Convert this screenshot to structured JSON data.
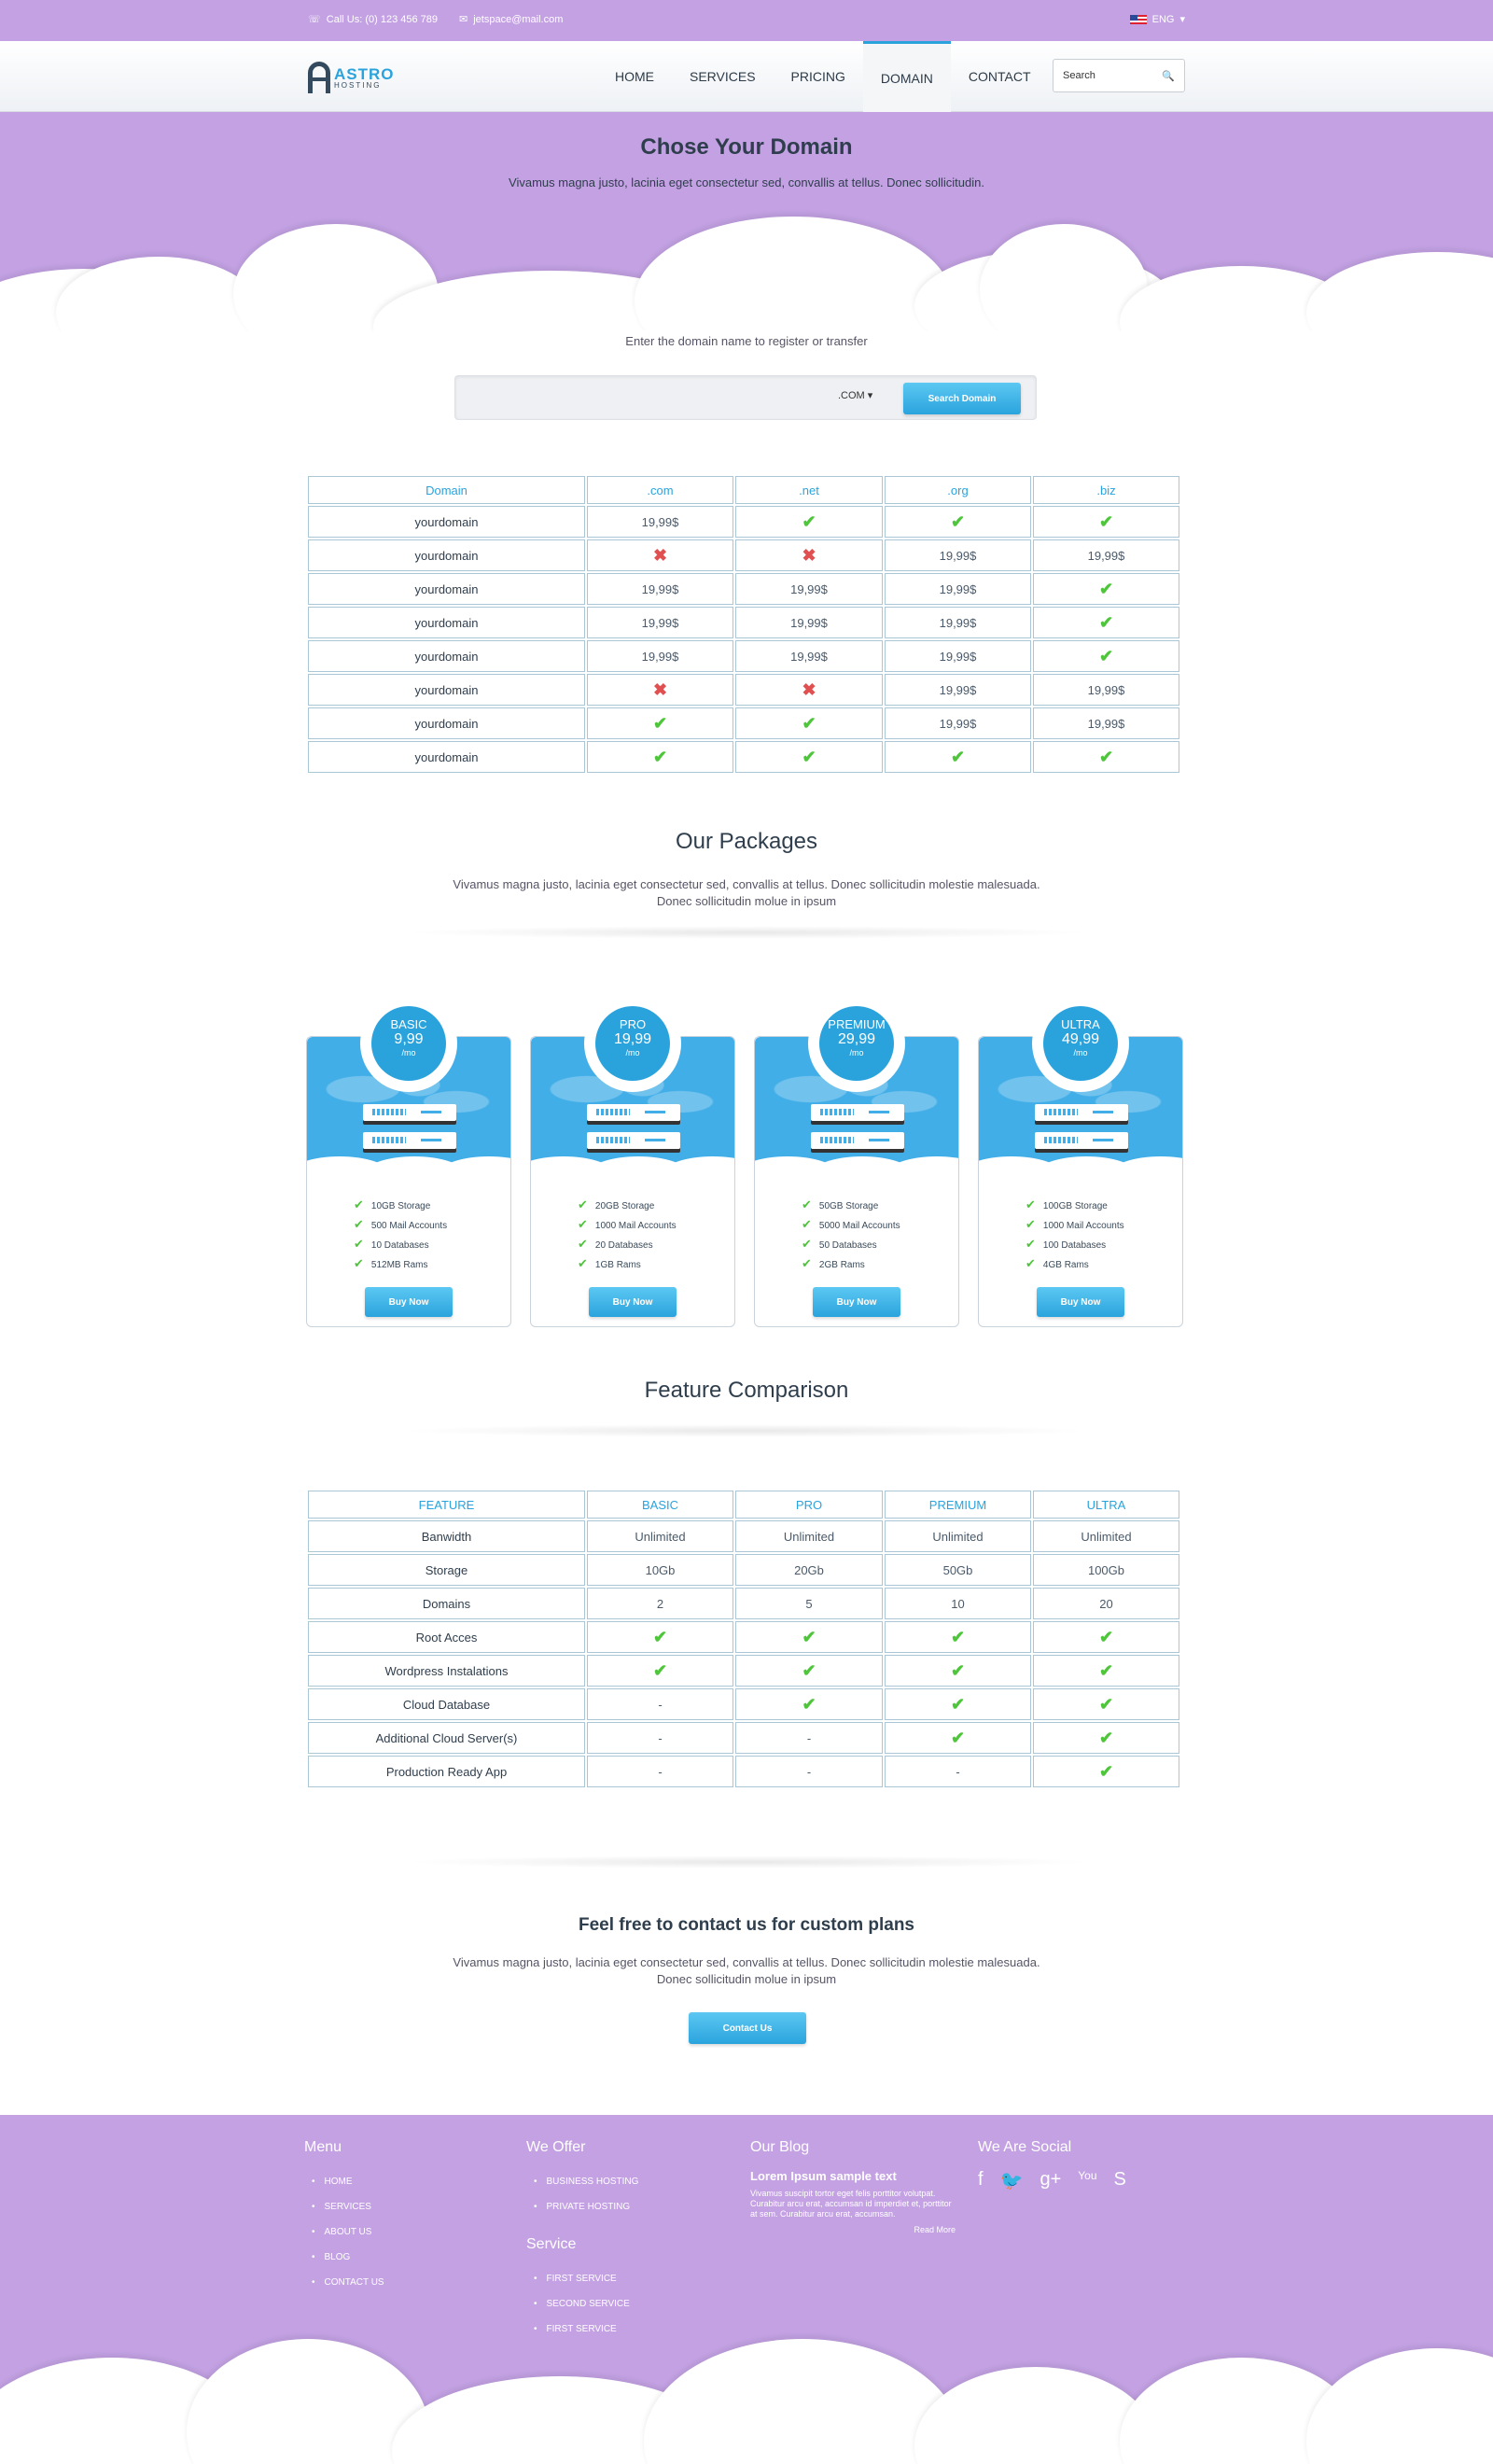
{
  "topbar": {
    "phone": "Call Us: (0) 123 456 789",
    "email": "jetspace@mail.com",
    "language": "ENG"
  },
  "brand": {
    "name": "ASTRO",
    "tagline": "HOSTING",
    "accent": "#2aa3dd",
    "bg": "#c3a1e3"
  },
  "nav": {
    "items": [
      "HOME",
      "SERVICES",
      "PRICING",
      "DOMAIN",
      "CONTACT"
    ],
    "active": "DOMAIN",
    "search_placeholder": "Search"
  },
  "hero": {
    "title": "Chose Your Domain",
    "subtitle": "Vivamus magna justo, lacinia eget consectetur sed, convallis at tellus. Donec sollicitudin."
  },
  "domain_search": {
    "label": "Enter the domain name to register or transfer",
    "tld": ".COM",
    "button": "Search Domain"
  },
  "domain_table": {
    "headers": [
      "Domain",
      ".com",
      ".net",
      ".org",
      ".biz"
    ],
    "rows": [
      [
        "yourdomain",
        "19,99$",
        "check",
        "check",
        "check"
      ],
      [
        "yourdomain",
        "cross",
        "cross",
        "19,99$",
        "19,99$"
      ],
      [
        "yourdomain",
        "19,99$",
        "19,99$",
        "19,99$",
        "check"
      ],
      [
        "yourdomain",
        "19,99$",
        "19,99$",
        "19,99$",
        "check"
      ],
      [
        "yourdomain",
        "19,99$",
        "19,99$",
        "19,99$",
        "check"
      ],
      [
        "yourdomain",
        "cross",
        "cross",
        "19,99$",
        "19,99$"
      ],
      [
        "yourdomain",
        "check",
        "check",
        "19,99$",
        "19,99$"
      ],
      [
        "yourdomain",
        "check",
        "check",
        "check",
        "check"
      ]
    ]
  },
  "packages": {
    "title": "Our Packages",
    "subtitle_1": "Vivamus magna justo, lacinia eget consectetur sed, convallis at tellus. Donec sollicitudin molestie malesuada.",
    "subtitle_2": "Donec sollicitudin molue in ipsum",
    "cards": [
      {
        "name": "BASIC",
        "price": "9,99",
        "per": "/mo",
        "features": [
          "10GB Storage",
          "500 Mail Accounts",
          "10 Databases",
          "512MB Rams"
        ],
        "button": "Buy Now"
      },
      {
        "name": "PRO",
        "price": "19,99",
        "per": "/mo",
        "features": [
          "20GB Storage",
          "1000 Mail Accounts",
          "20 Databases",
          "1GB Rams"
        ],
        "button": "Buy Now"
      },
      {
        "name": "PREMIUM",
        "price": "29,99",
        "per": "/mo",
        "features": [
          "50GB Storage",
          "5000 Mail Accounts",
          "50 Databases",
          "2GB Rams"
        ],
        "button": "Buy Now"
      },
      {
        "name": "ULTRA",
        "price": "49,99",
        "per": "/mo",
        "features": [
          "100GB Storage",
          "1000 Mail Accounts",
          "100 Databases",
          "4GB Rams"
        ],
        "button": "Buy Now"
      }
    ]
  },
  "comparison": {
    "title": "Feature Comparison",
    "headers": [
      "FEATURE",
      "BASIC",
      "PRO",
      "PREMIUM",
      "ULTRA"
    ],
    "rows": [
      [
        "Banwidth",
        "Unlimited",
        "Unlimited",
        "Unlimited",
        "Unlimited"
      ],
      [
        "Storage",
        "10Gb",
        "20Gb",
        "50Gb",
        "100Gb"
      ],
      [
        "Domains",
        "2",
        "5",
        "10",
        "20"
      ],
      [
        "Root Acces",
        "check",
        "check",
        "check",
        "check"
      ],
      [
        "Wordpress Instalations",
        "check",
        "check",
        "check",
        "check"
      ],
      [
        "Cloud Database",
        "-",
        "check",
        "check",
        "check"
      ],
      [
        "Additional Cloud Server(s)",
        "-",
        "-",
        "check",
        "check"
      ],
      [
        "Production Ready App",
        "-",
        "-",
        "-",
        "check"
      ]
    ]
  },
  "contact": {
    "title": "Feel free to contact us for custom plans",
    "subtitle_1": "Vivamus magna justo, lacinia eget consectetur sed, convallis at tellus. Donec sollicitudin molestie malesuada.",
    "subtitle_2": "Donec sollicitudin molue in ipsum",
    "button": "Contact Us"
  },
  "footer": {
    "menu_title": "Menu",
    "menu": [
      "HOME",
      "SERVICES",
      "ABOUT US",
      "BLOG",
      "CONTACT US"
    ],
    "offer_title": "We Offer",
    "offer": [
      "BUSINESS HOSTING",
      "PRIVATE HOSTING"
    ],
    "service_title": "Service",
    "service": [
      "FIRST SERVICE",
      "SECOND SERVICE",
      "FIRST SERVICE"
    ],
    "blog_title": "Our Blog",
    "blog_post_title": "Lorem Ipsum sample text",
    "blog_post_body": "Vivamus suscipit tortor eget felis porttitor volutpat. Curabitur arcu erat, accumsan id imperdiet et, porttitor at sem. Curabitur arcu erat, accumsan.",
    "read_more": "Read More",
    "social_title": "We Are Social",
    "social": [
      "f",
      "🐦",
      "g+",
      "You",
      "S"
    ]
  }
}
